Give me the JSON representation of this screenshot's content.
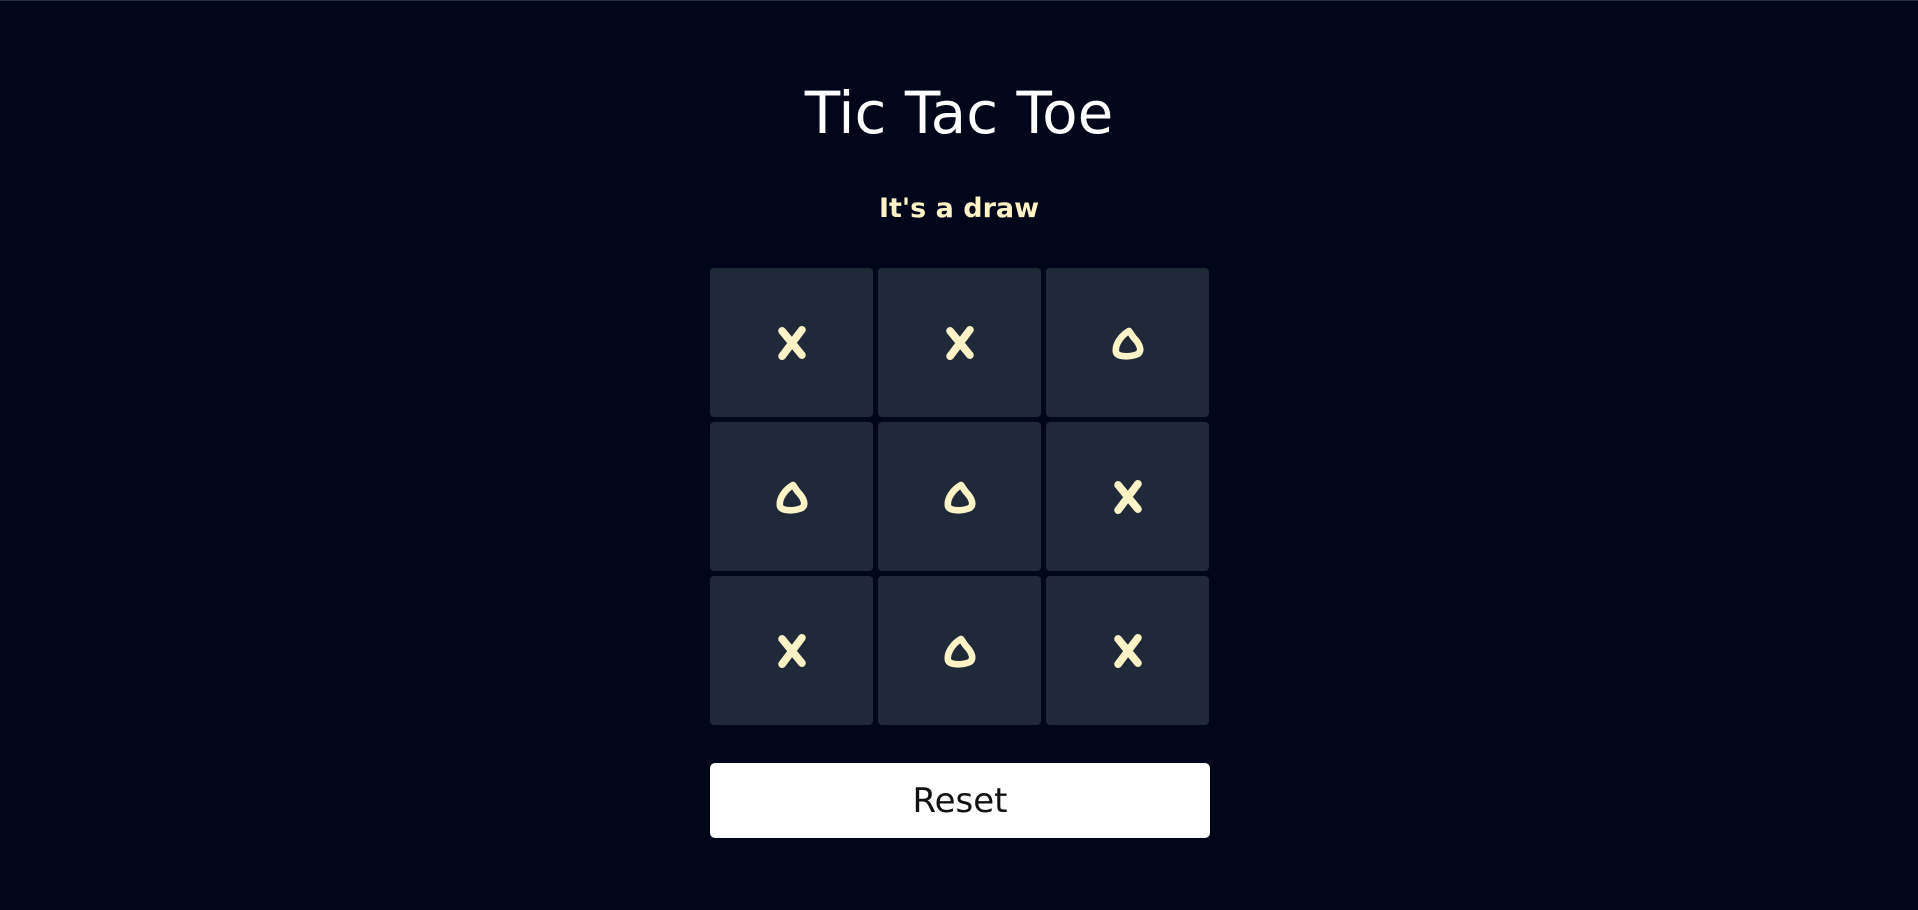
{
  "game": {
    "title": "Tic Tac Toe",
    "status": "It's a draw",
    "board": [
      "X",
      "X",
      "O",
      "O",
      "O",
      "X",
      "X",
      "O",
      "X"
    ],
    "reset_label": "Reset"
  },
  "colors": {
    "background": "#01061a",
    "cell": "#1f2937",
    "mark": "#fef3c7",
    "status": "#fef3c7",
    "title": "#ffffff",
    "button": "#ffffff"
  }
}
